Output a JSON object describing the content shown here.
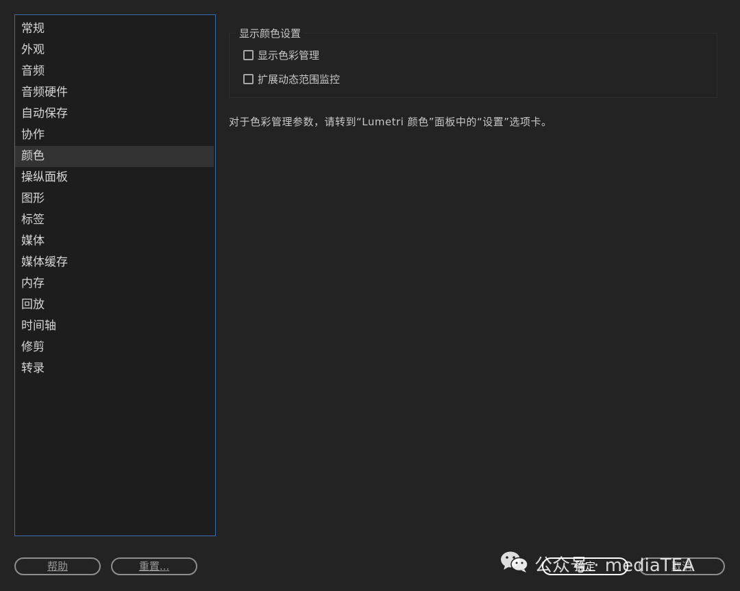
{
  "sidebar": {
    "items": [
      {
        "label": "常规"
      },
      {
        "label": "外观"
      },
      {
        "label": "音频"
      },
      {
        "label": "音频硬件"
      },
      {
        "label": "自动保存"
      },
      {
        "label": "协作"
      },
      {
        "label": "颜色",
        "selected": true
      },
      {
        "label": "操纵面板"
      },
      {
        "label": "图形"
      },
      {
        "label": "标签"
      },
      {
        "label": "媒体"
      },
      {
        "label": "媒体缓存"
      },
      {
        "label": "内存"
      },
      {
        "label": "回放"
      },
      {
        "label": "时间轴"
      },
      {
        "label": "修剪"
      },
      {
        "label": "转录"
      }
    ]
  },
  "display_color": {
    "group_title": "显示颜色设置",
    "options": [
      {
        "label": "显示色彩管理",
        "checked": false
      },
      {
        "label": "扩展动态范围监控",
        "checked": false
      }
    ]
  },
  "info_text": "对于色彩管理参数，请转到“Lumetri 颜色”面板中的“设置”选项卡。",
  "buttons": {
    "help": "帮助",
    "reset": "重置...",
    "ok": "确定",
    "cancel": "取消"
  },
  "watermark": {
    "icon": "wechat-icon",
    "text": "公众号 · mediaTEA"
  },
  "colors": {
    "background": "#232323",
    "sidebar_background": "#1d1d1d",
    "sidebar_border": "#3c6fae",
    "selected_item": "#333333"
  }
}
